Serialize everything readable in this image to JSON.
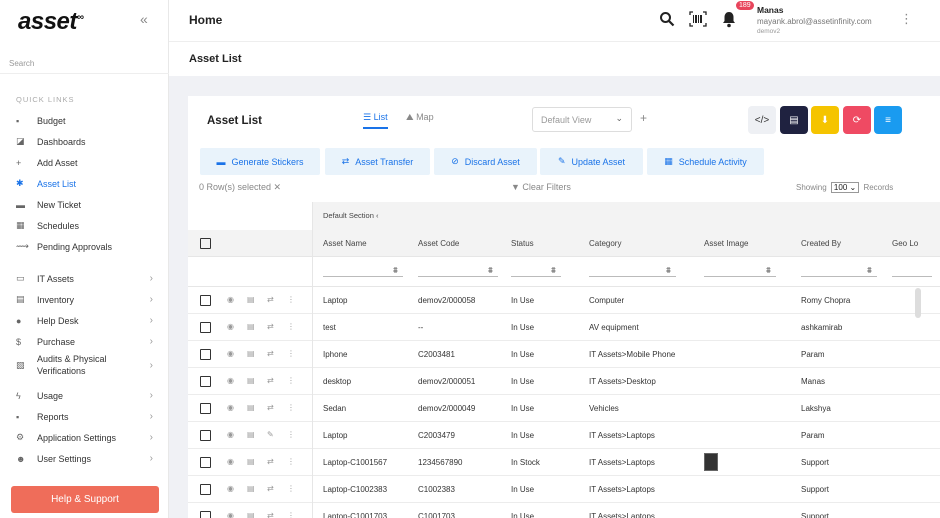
{
  "brand": {
    "logo": "asset",
    "logo_sup": "∞",
    "collapse_icon": "double-chevron-left-icon"
  },
  "sidebar": {
    "search_placeholder": "Search",
    "quick_links_label": "QUICK LINKS",
    "items": [
      {
        "label": "Budget",
        "icon": "file-icon",
        "glyph": "▪",
        "chevron": false,
        "active": false
      },
      {
        "label": "Dashboards",
        "icon": "dashboard-icon",
        "glyph": "◪",
        "chevron": false,
        "active": false
      },
      {
        "label": "Add Asset",
        "icon": "plus-icon",
        "glyph": "+",
        "chevron": false,
        "active": false
      },
      {
        "label": "Asset List",
        "icon": "asset-list-icon",
        "glyph": "✱",
        "chevron": false,
        "active": true
      },
      {
        "label": "New Ticket",
        "icon": "ticket-icon",
        "glyph": "▬",
        "chevron": false,
        "active": false
      },
      {
        "label": "Schedules",
        "icon": "calendar-icon",
        "glyph": "▦",
        "chevron": false,
        "active": false
      },
      {
        "label": "Pending Approvals",
        "icon": "approvals-icon",
        "glyph": "⟿",
        "chevron": false,
        "active": false
      },
      {
        "label": "IT Assets",
        "icon": "laptop-icon",
        "glyph": "▭",
        "chevron": true,
        "active": false
      },
      {
        "label": "Inventory",
        "icon": "inventory-icon",
        "glyph": "▤",
        "chevron": true,
        "active": false
      },
      {
        "label": "Help Desk",
        "icon": "help-icon",
        "glyph": "●",
        "chevron": true,
        "active": false
      },
      {
        "label": "Purchase",
        "icon": "dollar-icon",
        "glyph": "$",
        "chevron": true,
        "active": false
      },
      {
        "label": "Audits & Physical",
        "label2": "Verifications",
        "icon": "audit-icon",
        "glyph": "▧",
        "chevron": true,
        "active": false
      },
      {
        "label": "Usage",
        "icon": "usage-icon",
        "glyph": "ϟ",
        "chevron": true,
        "active": false
      },
      {
        "label": "Reports",
        "icon": "reports-icon",
        "glyph": "▪",
        "chevron": true,
        "active": false
      },
      {
        "label": "Application Settings",
        "icon": "wrench-icon",
        "glyph": "⚙",
        "chevron": true,
        "active": false
      },
      {
        "label": "User Settings",
        "icon": "user-settings-icon",
        "glyph": "☻",
        "chevron": true,
        "active": false
      }
    ],
    "help_button": "Help & Support"
  },
  "topbar": {
    "title": "Home",
    "notification_count": "189",
    "user_name": "Manas",
    "user_email": "mayank.abrol@assetinfinity.com",
    "user_org": "demov2"
  },
  "subbar": {
    "title": "Asset List"
  },
  "card": {
    "title": "Asset List",
    "view_tabs": [
      {
        "label": "List",
        "icon": "list-icon",
        "active": true
      },
      {
        "label": "Map",
        "icon": "map-icon",
        "active": false
      }
    ],
    "view_select": "Default View",
    "square_buttons": [
      {
        "name": "code-button",
        "icon": "code-icon",
        "glyph": "</>",
        "bg": "#eef0f4",
        "fg": "#333"
      },
      {
        "name": "export-file-button",
        "icon": "file-icon",
        "glyph": "▤",
        "bg": "#1f2240",
        "fg": "#ffffff"
      },
      {
        "name": "download-button",
        "icon": "download-icon",
        "glyph": "⬇",
        "bg": "#f5c400",
        "fg": "#ffffff"
      },
      {
        "name": "refresh-button",
        "icon": "refresh-icon",
        "glyph": "⟳",
        "bg": "#ef4a63",
        "fg": "#ffffff"
      },
      {
        "name": "menu-button",
        "icon": "menu-icon",
        "glyph": "≡",
        "bg": "#1a9bf0",
        "fg": "#ffffff"
      }
    ],
    "actions": [
      {
        "label": "Generate Stickers",
        "icon": "sticker-icon",
        "glyph": "▬"
      },
      {
        "label": "Asset Transfer",
        "icon": "transfer-icon",
        "glyph": "⇄"
      },
      {
        "label": "Discard Asset",
        "icon": "discard-icon",
        "glyph": "⊘"
      },
      {
        "label": "Update Asset",
        "icon": "edit-icon",
        "glyph": "✎"
      },
      {
        "label": "Schedule Activity",
        "icon": "calendar-icon",
        "glyph": "▦"
      }
    ],
    "rows_selected": "0  Row(s) selected",
    "clear_filters": "Clear Filters",
    "showing_label": "Showing",
    "page_size": "100",
    "records_label": "Records"
  },
  "table": {
    "section_label": "Default Section",
    "columns": [
      "Asset Name",
      "Asset Code",
      "Status",
      "Category",
      "Asset Image",
      "Created By",
      "Geo Lo"
    ],
    "rows": [
      {
        "name": "Laptop",
        "code": "demov2/000058",
        "status": "In Use",
        "category": "Computer",
        "image": false,
        "created_by": "Romy Chopra"
      },
      {
        "name": "test",
        "code": "--",
        "status": "In Use",
        "category": "AV equipment",
        "image": false,
        "created_by": "ashkamirab"
      },
      {
        "name": "Iphone",
        "code": "C2003481",
        "status": "In Use",
        "category": "IT Assets>Mobile Phone",
        "image": false,
        "created_by": "Param"
      },
      {
        "name": "desktop",
        "code": "demov2/000051",
        "status": "In Use",
        "category": "IT Assets>Desktop",
        "image": false,
        "created_by": "Manas"
      },
      {
        "name": "Sedan",
        "code": "demov2/000049",
        "status": "In Use",
        "category": "Vehicles",
        "image": false,
        "created_by": "Lakshya"
      },
      {
        "name": "Laptop",
        "code": "C2003479",
        "status": "In Use",
        "category": "IT Assets>Laptops",
        "image": false,
        "created_by": "Param"
      },
      {
        "name": "Laptop-C1001567",
        "code": "1234567890",
        "status": "In Stock",
        "category": "IT Assets>Laptops",
        "image": true,
        "created_by": "Support"
      },
      {
        "name": "Laptop-C1002383",
        "code": "C1002383",
        "status": "In Use",
        "category": "IT Assets>Laptops",
        "image": false,
        "created_by": "Support"
      },
      {
        "name": "Laptop-C1001703",
        "code": "C1001703",
        "status": "In Use",
        "category": "IT Assets>Laptops",
        "image": false,
        "created_by": "Support"
      }
    ]
  }
}
